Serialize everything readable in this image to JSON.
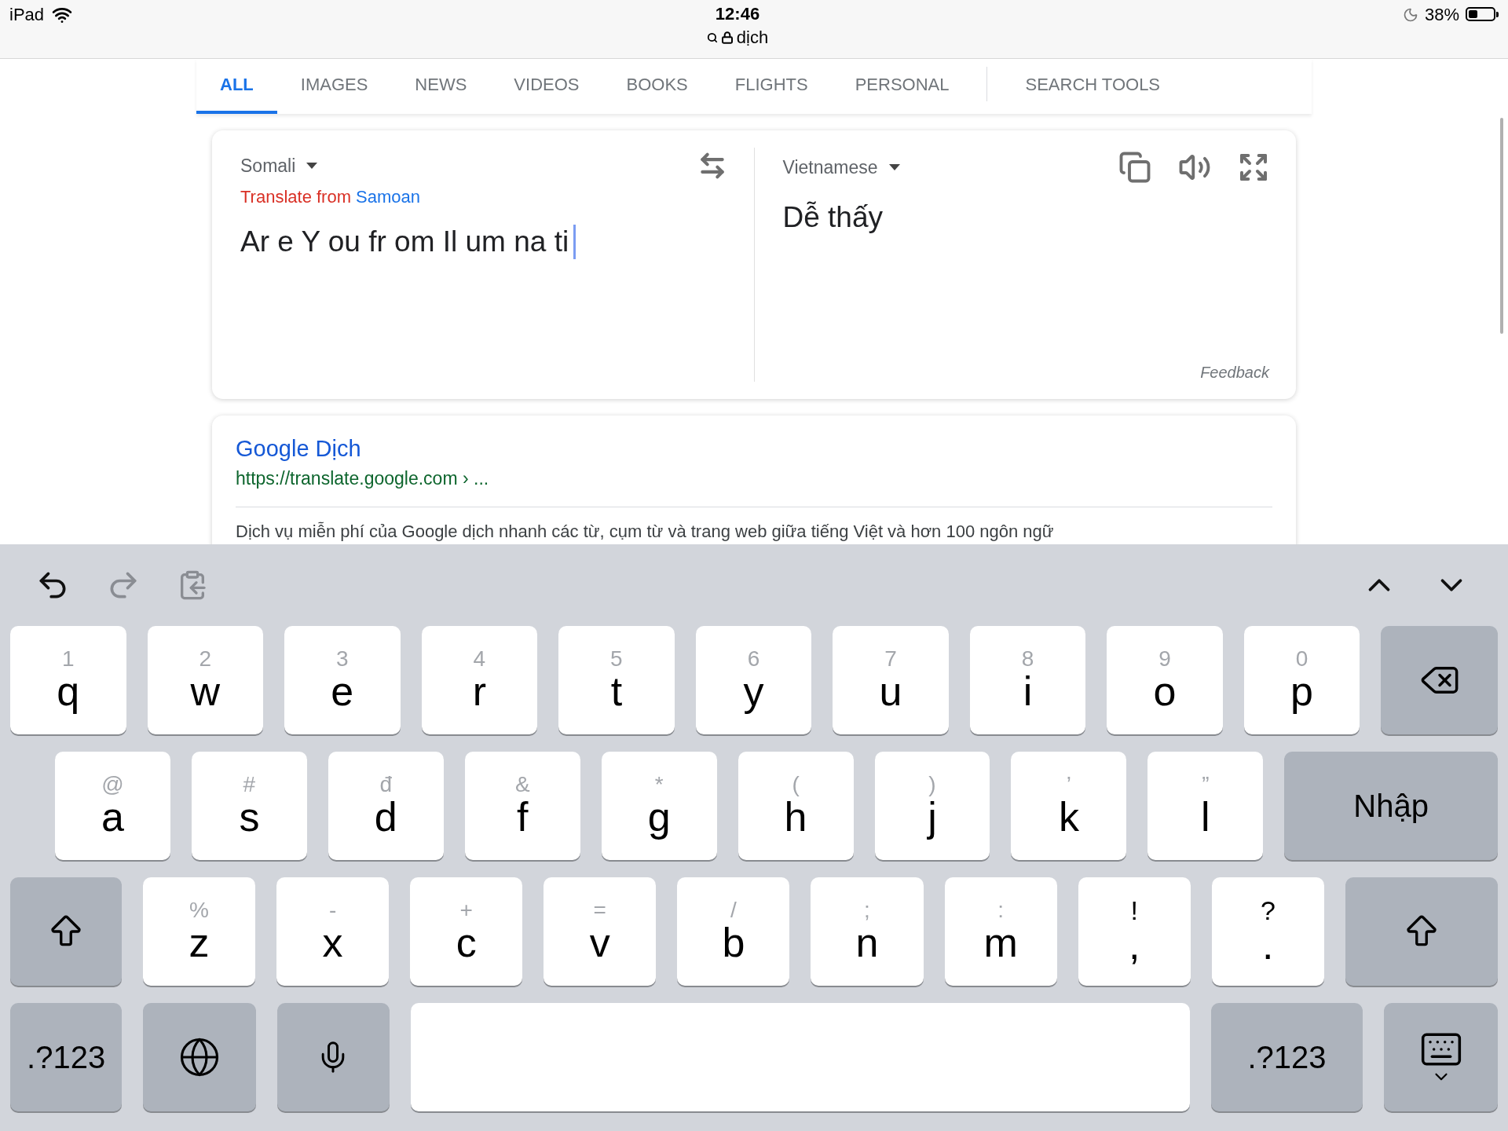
{
  "status_bar": {
    "device": "iPad",
    "time": "12:46",
    "url": "dịch",
    "battery": "38%"
  },
  "tabs": [
    {
      "label": "ALL",
      "selected": true
    },
    {
      "label": "IMAGES",
      "selected": false
    },
    {
      "label": "NEWS",
      "selected": false
    },
    {
      "label": "VIDEOS",
      "selected": false
    },
    {
      "label": "BOOKS",
      "selected": false
    },
    {
      "label": "FLIGHTS",
      "selected": false
    },
    {
      "label": "PERSONAL",
      "selected": false
    },
    {
      "label": "SEARCH TOOLS",
      "selected": false
    }
  ],
  "translator": {
    "source_language": "Somali",
    "suggestion_prefix": "Translate from",
    "suggestion_language": "Samoan",
    "input": "Ar e Y ou fr om Il um na ti",
    "target_language": "Vietnamese",
    "output": "Dễ thấy",
    "feedback": "Feedback"
  },
  "result": {
    "title": "Google Dịch",
    "url": "https://translate.google.com › ...",
    "snippet": "Dịch vụ miễn phí của Google dịch nhanh các từ, cụm từ và trang web giữa tiếng Việt và hơn 100 ngôn ngữ"
  },
  "keyboard": {
    "toolbar": [
      {
        "kind": "undo",
        "disabled": false
      },
      {
        "kind": "redo",
        "disabled": true
      },
      {
        "kind": "paste",
        "disabled": true
      }
    ],
    "rows": [
      {
        "keys": [
          {
            "kind": "letter",
            "label": "q",
            "hint": "1"
          },
          {
            "kind": "letter",
            "label": "w",
            "hint": "2"
          },
          {
            "kind": "letter",
            "label": "e",
            "hint": "3"
          },
          {
            "kind": "letter",
            "label": "r",
            "hint": "4"
          },
          {
            "kind": "letter",
            "label": "t",
            "hint": "5"
          },
          {
            "kind": "letter",
            "label": "y",
            "hint": "6"
          },
          {
            "kind": "letter",
            "label": "u",
            "hint": "7"
          },
          {
            "kind": "letter",
            "label": "i",
            "hint": "8"
          },
          {
            "kind": "letter",
            "label": "o",
            "hint": "9"
          },
          {
            "kind": "letter",
            "label": "p",
            "hint": "0"
          },
          {
            "kind": "delete"
          }
        ]
      },
      {
        "keys": [
          {
            "kind": "letter",
            "label": "a",
            "hint": "@"
          },
          {
            "kind": "letter",
            "label": "s",
            "hint": "#"
          },
          {
            "kind": "letter",
            "label": "d",
            "hint": "đ"
          },
          {
            "kind": "letter",
            "label": "f",
            "hint": "&"
          },
          {
            "kind": "letter",
            "label": "g",
            "hint": "*"
          },
          {
            "kind": "letter",
            "label": "h",
            "hint": "("
          },
          {
            "kind": "letter",
            "label": "j",
            "hint": ")"
          },
          {
            "kind": "letter",
            "label": "k",
            "hint": "’"
          },
          {
            "kind": "letter",
            "label": "l",
            "hint": "”"
          },
          {
            "kind": "enter",
            "label": "Nhập"
          }
        ]
      },
      {
        "keys": [
          {
            "kind": "shift"
          },
          {
            "kind": "letter",
            "label": "z",
            "hint": "%"
          },
          {
            "kind": "letter",
            "label": "x",
            "hint": "-"
          },
          {
            "kind": "letter",
            "label": "c",
            "hint": "+"
          },
          {
            "kind": "letter",
            "label": "v",
            "hint": "="
          },
          {
            "kind": "letter",
            "label": "b",
            "hint": "/"
          },
          {
            "kind": "letter",
            "label": "n",
            "hint": ";"
          },
          {
            "kind": "letter",
            "label": "m",
            "hint": ":"
          },
          {
            "kind": "punct",
            "label": ",",
            "hint": "!"
          },
          {
            "kind": "punct",
            "label": ".",
            "hint": "?"
          },
          {
            "kind": "shift"
          }
        ]
      },
      {
        "keys": [
          {
            "kind": "mode",
            "label": ".?123"
          },
          {
            "kind": "globe"
          },
          {
            "kind": "mic"
          },
          {
            "kind": "space"
          },
          {
            "kind": "mode",
            "label": ".?123"
          },
          {
            "kind": "hide"
          }
        ]
      }
    ]
  }
}
